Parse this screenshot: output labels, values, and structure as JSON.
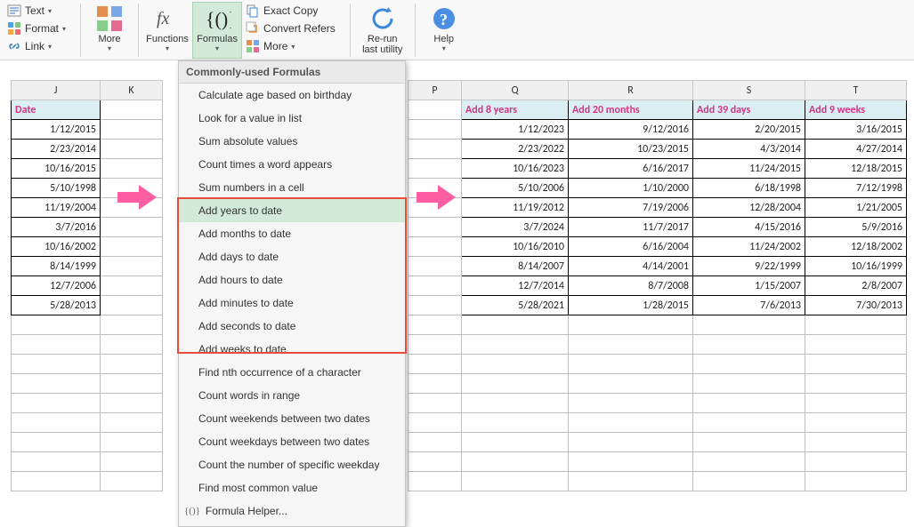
{
  "ribbon": {
    "text_label": "Text",
    "format_label": "Format",
    "link_label": "Link",
    "more1_label": "More",
    "functions_label": "Functions",
    "formulas_label": "Formulas",
    "exact_copy_label": "Exact Copy",
    "convert_refers_label": "Convert Refers",
    "more2_label": "More",
    "rerun_label": "Re-run\nlast utility",
    "help_label": "Help"
  },
  "menu": {
    "header": "Commonly-used Formulas",
    "items": [
      "Calculate age based on birthday",
      "Look for a value in list",
      "Sum absolute values",
      "Count times a word appears",
      "Sum numbers in a cell",
      "Add years to date",
      "Add months to date",
      "Add days to date",
      "Add hours to date",
      "Add minutes to date",
      "Add seconds to date",
      "Add weeks to date",
      "Find nth occurrence of a character",
      "Count words in range",
      "Count weekends between two dates",
      "Count weekdays between two dates",
      "Count the number of specific weekday",
      "Find most common value"
    ],
    "formula_helper": "Formula Helper..."
  },
  "left": {
    "cols": [
      "J",
      "K"
    ],
    "header": "Date",
    "rows": [
      "1/12/2015",
      "2/23/2014",
      "10/16/2015",
      "5/10/1998",
      "11/19/2004",
      "3/7/2016",
      "10/16/2002",
      "8/14/1999",
      "12/7/2006",
      "5/28/2013"
    ]
  },
  "right": {
    "cols": [
      "P",
      "Q",
      "R",
      "S",
      "T"
    ],
    "headers": [
      "Add 8 years",
      "Add 20 months",
      "Add 39 days",
      "Add 9 weeks"
    ],
    "rows": [
      [
        "1/12/2023",
        "9/12/2016",
        "2/20/2015",
        "3/16/2015"
      ],
      [
        "2/23/2022",
        "10/23/2015",
        "4/3/2014",
        "4/27/2014"
      ],
      [
        "10/16/2023",
        "6/16/2017",
        "11/24/2015",
        "12/18/2015"
      ],
      [
        "5/10/2006",
        "1/10/2000",
        "6/18/1998",
        "7/12/1998"
      ],
      [
        "11/19/2012",
        "7/19/2006",
        "12/28/2004",
        "1/21/2005"
      ],
      [
        "3/7/2024",
        "11/7/2017",
        "4/15/2016",
        "5/9/2016"
      ],
      [
        "10/16/2010",
        "6/16/2004",
        "11/24/2002",
        "12/18/2002"
      ],
      [
        "8/14/2007",
        "4/14/2001",
        "9/22/1999",
        "10/16/1999"
      ],
      [
        "12/7/2014",
        "8/7/2008",
        "1/15/2007",
        "2/8/2007"
      ],
      [
        "5/28/2021",
        "1/28/2015",
        "7/6/2013",
        "7/30/2013"
      ]
    ]
  },
  "highlight_indices": [
    5,
    6,
    7,
    8,
    9,
    10,
    11
  ]
}
